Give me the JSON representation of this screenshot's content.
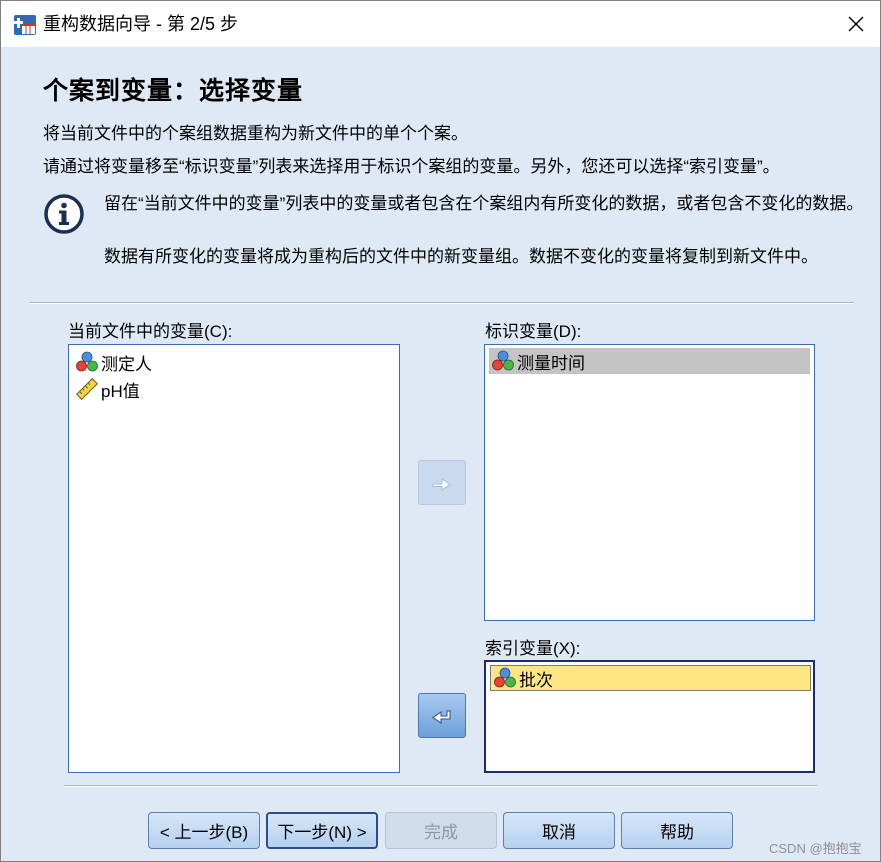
{
  "window": {
    "title": "重构数据向导 - 第 2/5 步"
  },
  "heading": "个案到变量：选择变量",
  "intro": {
    "line1": "将当前文件中的个案组数据重构为新文件中的单个个案。",
    "line2": "请通过将变量移至“标识变量”列表来选择用于标识个案组的变量。另外，您还可以选择“索引变量”。"
  },
  "info": {
    "note1": "留在“当前文件中的变量”列表中的变量或者包含在个案组内有所变化的数据，或者包含不变化的数据。",
    "note2": "数据有所变化的变量将成为重构后的文件中的新变量组。数据不变化的变量将复制到新文件中。"
  },
  "current_vars": {
    "label": "当前文件中的变量(C):",
    "items": [
      {
        "name": "测定人",
        "icon": "nominal-variable-icon"
      },
      {
        "name": "pH值",
        "icon": "scale-variable-icon"
      }
    ]
  },
  "id_vars": {
    "label": "标识变量(D):",
    "items": [
      {
        "name": "测量时间",
        "icon": "nominal-variable-icon",
        "selected": true
      }
    ]
  },
  "index_vars": {
    "label": "索引变量(X):",
    "items": [
      {
        "name": "批次",
        "icon": "nominal-variable-icon",
        "selected": true
      }
    ]
  },
  "buttons": {
    "back": "< 上一步(B)",
    "next": "下一步(N) >",
    "finish": "完成",
    "cancel": "取消",
    "help": "帮助"
  },
  "watermark": "CSDN @抱抱宝",
  "colors": {
    "dialog_bg": "#dfe9f5",
    "list_border": "#3a6fb0",
    "selected_gray": "#c4c4c4",
    "selected_yellow": "#ffe680"
  }
}
